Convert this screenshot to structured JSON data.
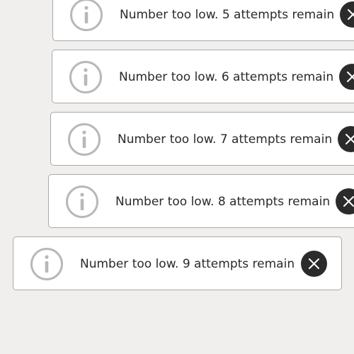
{
  "toasts": [
    {
      "message": "Number too low. 5 attempts remain",
      "icon": "info-icon",
      "close_icon": "close-icon"
    },
    {
      "message": "Number too low. 6 attempts remain",
      "icon": "info-icon",
      "close_icon": "close-icon"
    },
    {
      "message": "Number too low. 7 attempts remain",
      "icon": "info-icon",
      "close_icon": "close-icon"
    },
    {
      "message": "Number too low. 8 attempts remain",
      "icon": "info-icon",
      "close_icon": "close-icon"
    },
    {
      "message": "Number too low. 9 attempts remain",
      "icon": "info-icon",
      "close_icon": "close-icon"
    }
  ],
  "colors": {
    "background": "#f0efed",
    "toast_background": "#ffffff",
    "toast_border": "#a9a9a9",
    "info_icon": "#b8b8b8",
    "close_button": "#2b2b2b"
  }
}
